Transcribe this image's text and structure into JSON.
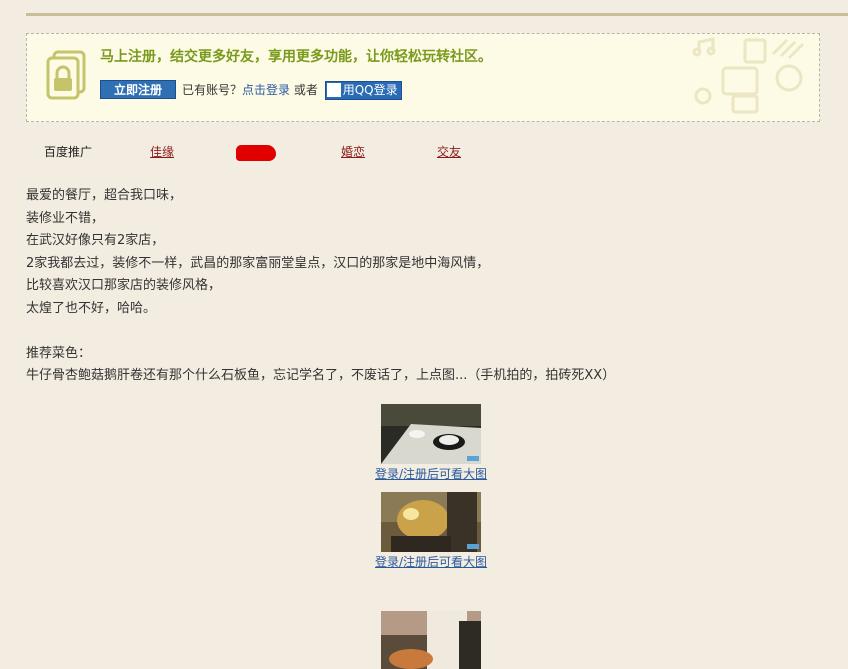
{
  "register": {
    "title": "马上注册，结交更多好友，享用更多功能，让你轻松玩转社区。",
    "register_button": "立即注册",
    "have_account": "已有账号？",
    "login_link": "点击登录",
    "or": "或者",
    "qq_button": "用QQ登录"
  },
  "ads": {
    "label": "百度推广",
    "links": [
      "佳缘",
      "婚恋",
      "交友"
    ]
  },
  "post": {
    "lines": [
      "最爱的餐厅，超合我口味，",
      "装修业不错，",
      "在武汉好像只有2家店，",
      "2家我都去过，装修不一样，武昌的那家富丽堂皇点，汉口的那家是地中海风情，",
      "比较喜欢汉口那家店的装修风格，",
      "太煌了也不好，哈哈。"
    ],
    "dishes_title": "推荐菜色：",
    "dishes_text": "牛仔骨杏鲍菇鹅肝卷还有那个什么石板鱼，忘记学名了，不废话了，上点图...（手机拍的，拍砖死XX）"
  },
  "images": [
    {
      "caption": "登录/注册后可看大图"
    },
    {
      "caption": "登录/注册后可看大图"
    },
    {
      "caption": ""
    }
  ],
  "colors": {
    "background": "#f3ece1",
    "register_title": "#7a9a1d",
    "register_button": "#2f6fb4",
    "link_blue": "#2a5a9e",
    "ad_link": "#8b1a1a"
  }
}
